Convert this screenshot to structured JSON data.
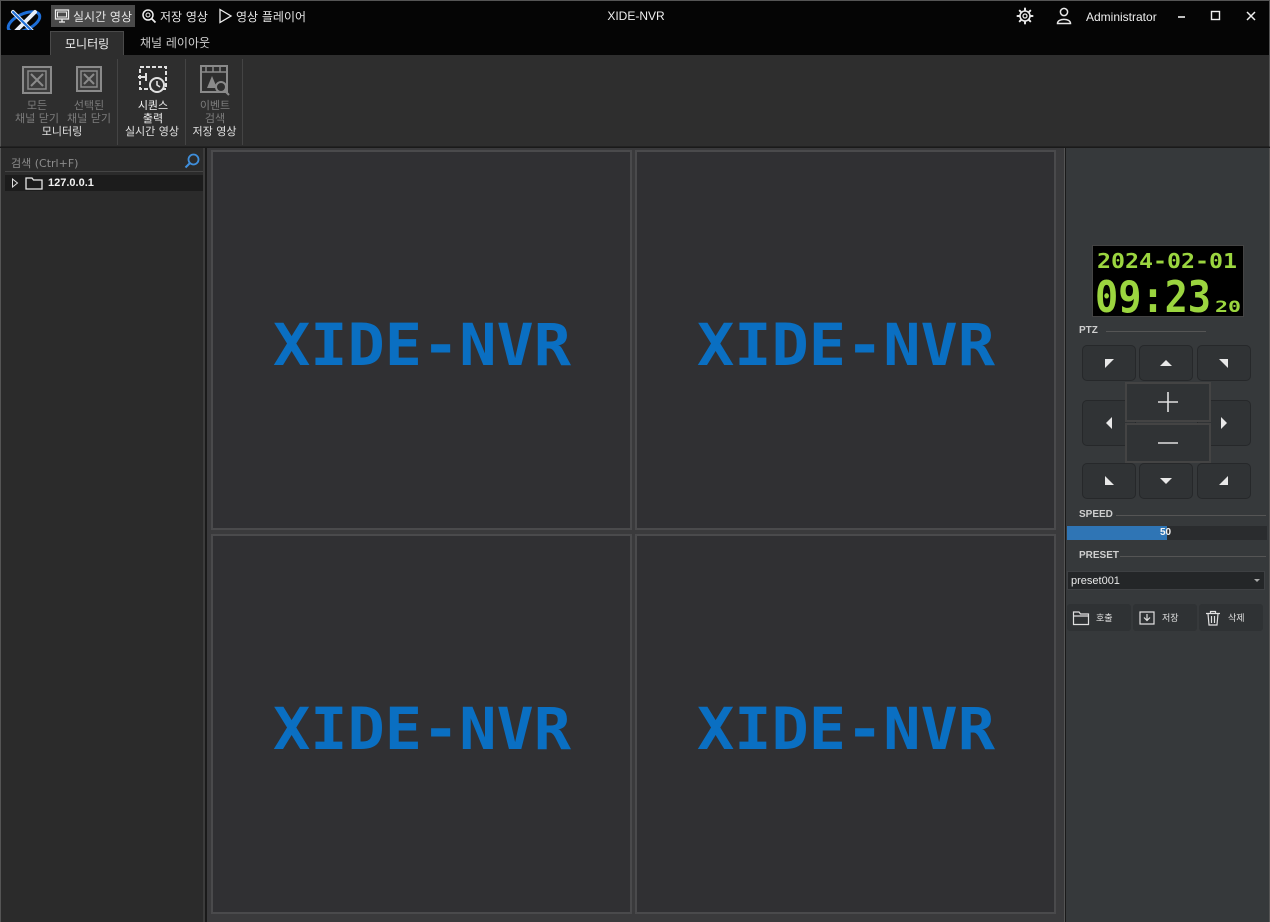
{
  "app": {
    "title": "XIDE-NVR",
    "user": "Administrator"
  },
  "nav": {
    "live": "실시간 영상",
    "stored": "저장 영상",
    "player": "영상 플레이어"
  },
  "tabs": {
    "monitoring": "모니터링",
    "layout": "채널 레이아웃"
  },
  "ribbon": {
    "close_all_line1": "모든",
    "close_all_line2": "채널 닫기",
    "close_selected_line1": "선택된",
    "close_selected_line2": "채널 닫기",
    "group_monitoring": "모니터링",
    "sequence_line1": "시퀀스",
    "sequence_line2": "출력",
    "group_live": "실시간 영상",
    "event_line1": "이벤트",
    "event_line2": "검색",
    "group_stored": "저장 영상"
  },
  "sidebar": {
    "search_placeholder": "검색 (Ctrl+F)",
    "tree_root": "127.0.0.1"
  },
  "video": {
    "watermark": "XIDE-NVR"
  },
  "clock": {
    "date": "2024-02-01",
    "time": "09:23",
    "seconds": "20"
  },
  "ptz": {
    "label": "PTZ",
    "speed_label": "SPEED",
    "speed_value": "50",
    "speed_fraction": 0.5,
    "preset_label": "PRESET",
    "preset_value": "preset001",
    "call": "호출",
    "save": "저장",
    "delete": "삭제"
  },
  "colors": {
    "accent": "#2f75b5",
    "watermark": "#0a6fc2",
    "clock_digit": "#9bd53f"
  }
}
